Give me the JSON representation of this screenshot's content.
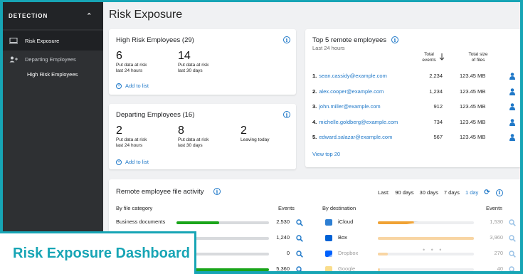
{
  "sidebar": {
    "header": "DETECTION",
    "items": [
      {
        "label": "Risk Exposure"
      },
      {
        "label": "Departing Employees"
      }
    ],
    "sub_items": [
      "High Risk Employees"
    ]
  },
  "page_title": "Risk Exposure",
  "high_risk_card": {
    "title": "High Risk Employees (29)",
    "stats": [
      {
        "value": "6",
        "label": "Put data at risk\nlast 24 hours"
      },
      {
        "value": "14",
        "label": "Put data at risk\nlast 30 days"
      }
    ],
    "link": "Add to list"
  },
  "departing_card": {
    "title": "Departing Employees (16)",
    "stats": [
      {
        "value": "2",
        "label": "Put data at risk\nlast 24 hours"
      },
      {
        "value": "8",
        "label": "Put data at risk\nlast 30 days"
      },
      {
        "value": "2",
        "label": "Leaving today"
      }
    ],
    "link": "Add to list"
  },
  "top5": {
    "title": "Top 5 remote employees",
    "subtitle": "Last 24 hours",
    "col_events": "Total\nevents",
    "col_size": "Total size\nof files",
    "rows": [
      {
        "rank": "1.",
        "email": "sean.cassidy@example.com",
        "events": "2,234",
        "size": "123.45 MB"
      },
      {
        "rank": "2.",
        "email": "alex.cooper@example.com",
        "events": "1,234",
        "size": "123.45 MB"
      },
      {
        "rank": "3.",
        "email": "john.miller@example.com",
        "events": "912",
        "size": "123.45 MB"
      },
      {
        "rank": "4.",
        "email": "michelle.goldberg@example.com",
        "events": "734",
        "size": "123.45 MB"
      },
      {
        "rank": "5.",
        "email": "edward.salazar@example.com",
        "events": "567",
        "size": "123.45 MB"
      }
    ],
    "view_link": "View top 20"
  },
  "activity": {
    "title": "Remote employee file activity",
    "filter_label": "Last:",
    "filters": [
      "90 days",
      "30 days",
      "7 days",
      "1 day"
    ],
    "selected_filter": "1 day",
    "by_category": {
      "heading": "By file category",
      "events_heading": "Events",
      "rows": [
        {
          "label": "Business documents",
          "value": "2,530",
          "fraction": 0.46
        },
        {
          "label": "",
          "value": "1,240",
          "fraction": 0.0
        },
        {
          "label": "",
          "value": "0",
          "fraction": 0.0
        },
        {
          "label": "",
          "value": "5,360",
          "fraction": 1.0
        }
      ]
    },
    "by_destination": {
      "heading": "By destination",
      "events_heading": "Events",
      "rows": [
        {
          "label": "iCloud",
          "value": "1,530",
          "fraction": 0.38,
          "icon": "icloud-icon",
          "color": "#2d7fd3"
        },
        {
          "label": "Box",
          "value": "3,960",
          "fraction": 1.0,
          "icon": "box-icon",
          "color": "#0061d5"
        },
        {
          "label": "Dropbox",
          "value": "270",
          "fraction": 0.1,
          "icon": "dropbox-icon",
          "color": "#0061fe"
        },
        {
          "label": "Google",
          "value": "40",
          "fraction": 0.02,
          "icon": "google-drive-icon",
          "color": "#f4b400"
        }
      ]
    }
  },
  "banner": "Risk Exposure Dashboard",
  "colors": {
    "accent": "#1f78c8",
    "green": "#1aa51a",
    "orange": "#f0a234",
    "teal": "#17a5b5"
  }
}
